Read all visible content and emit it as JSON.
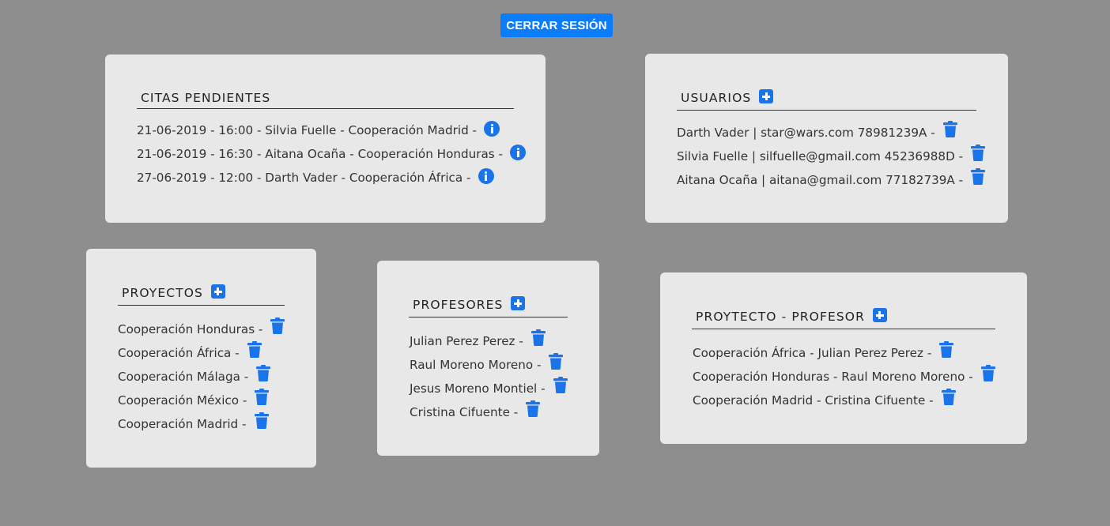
{
  "header": {
    "logout_label": "CERRAR SESIÓN"
  },
  "colors": {
    "background": "#8e8e8e",
    "card": "#e8e8e8",
    "accent": "#1a73e8",
    "button": "#0b7dfb"
  },
  "citas": {
    "title": "CITAS PENDIENTES",
    "items": [
      "21-06-2019 - 16:00 - Silvia Fuelle - Cooperación Madrid -",
      "21-06-2019 - 16:30 - Aitana Ocaña - Cooperación Honduras -",
      "27-06-2019 - 12:00 - Darth Vader - Cooperación África -"
    ],
    "item_icon": "info-icon"
  },
  "usuarios": {
    "title": "USUARIOS",
    "items": [
      "Darth Vader | star@wars.com 78981239A -",
      "Silvia Fuelle | silfuelle@gmail.com 45236988D -",
      "Aitana Ocaña | aitana@gmail.com 77182739A -"
    ],
    "item_icon": "trash-icon"
  },
  "proyectos": {
    "title": "PROYECTOS",
    "items": [
      "Cooperación Honduras -",
      "Cooperación África -",
      "Cooperación Málaga -",
      "Cooperación México -",
      "Cooperación Madrid -"
    ],
    "item_icon": "trash-icon"
  },
  "profesores": {
    "title": "PROFESORES",
    "items": [
      "Julian Perez Perez -",
      "Raul Moreno Moreno -",
      "Jesus Moreno Montiel -",
      "Cristina Cifuente -"
    ],
    "item_icon": "trash-icon"
  },
  "proyecto_profesor": {
    "title": "PROYTECTO - PROFESOR",
    "items": [
      "Cooperación África - Julian Perez Perez -",
      "Cooperación Honduras - Raul Moreno Moreno -",
      "Cooperación Madrid - Cristina Cifuente -"
    ],
    "item_icon": "trash-icon"
  }
}
